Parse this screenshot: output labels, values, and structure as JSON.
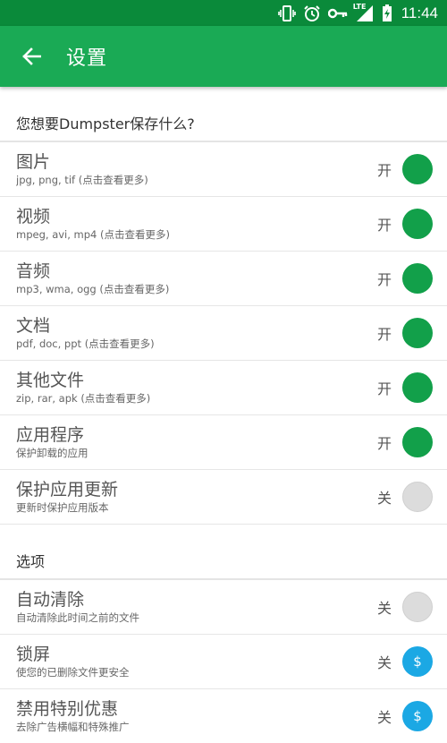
{
  "status_bar": {
    "icons": [
      "vibrate-icon",
      "alarm-icon",
      "vpn-key-icon",
      "lte-signal-icon",
      "battery-charging-icon"
    ],
    "lte": "LTE",
    "time": "11:44"
  },
  "app_bar": {
    "title": "设置"
  },
  "section_files": {
    "header": "您想要Dumpster保存什么?",
    "items": [
      {
        "title": "图片",
        "subtitle": "jpg, png, tif (点击查看更多)",
        "state": "开",
        "toggle": "on"
      },
      {
        "title": "视频",
        "subtitle": "mpeg, avi, mp4 (点击查看更多)",
        "state": "开",
        "toggle": "on"
      },
      {
        "title": "音频",
        "subtitle": "mp3, wma, ogg (点击查看更多)",
        "state": "开",
        "toggle": "on"
      },
      {
        "title": "文档",
        "subtitle": "pdf, doc, ppt (点击查看更多)",
        "state": "开",
        "toggle": "on"
      },
      {
        "title": "其他文件",
        "subtitle": "zip, rar, apk (点击查看更多)",
        "state": "开",
        "toggle": "on"
      },
      {
        "title": "应用程序",
        "subtitle": "保护卸载的应用",
        "state": "开",
        "toggle": "on"
      },
      {
        "title": "保护应用更新",
        "subtitle": "更新时保护应用版本",
        "state": "关",
        "toggle": "off"
      }
    ]
  },
  "section_options": {
    "header": "选项",
    "items": [
      {
        "title": "自动清除",
        "subtitle": "自动清除此时间之前的文件",
        "state": "关",
        "toggle": "off"
      },
      {
        "title": "锁屏",
        "subtitle": "使您的已删除文件更安全",
        "state": "关",
        "toggle": "premium",
        "badge": "$"
      },
      {
        "title": "禁用特别优惠",
        "subtitle": "去除广告横幅和特殊推广",
        "state": "关",
        "toggle": "premium",
        "badge": "$"
      }
    ]
  },
  "colors": {
    "status_bar": "#0a8a3a",
    "app_bar": "#1aaa55",
    "toggle_on": "#12a04a",
    "toggle_off": "#dcdcdc",
    "premium": "#1ba8e4"
  }
}
